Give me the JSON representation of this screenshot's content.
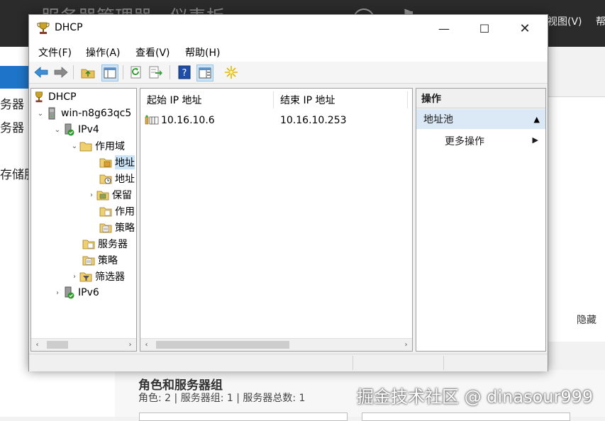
{
  "background_window": {
    "title_fragment": "服务器管理器 · 仪表板",
    "menu_view": "视图(V)",
    "menu_help": "帮",
    "left_items": [
      "务器",
      "务器",
      "存储服"
    ],
    "hide_label": "隐藏",
    "section_title": "角色和服务器组",
    "section_subtitle": "角色: 2 | 服务器组: 1 | 服务器总数: 1"
  },
  "window": {
    "title": "DHCP",
    "minimize": "—",
    "maximize": "☐",
    "close": "✕"
  },
  "menu": [
    "文件(F)",
    "操作(A)",
    "查看(V)",
    "帮助(H)"
  ],
  "tree": {
    "root": "DHCP",
    "server": "win-n8g63qc5",
    "ipv4": "IPv4",
    "scope": "作用域",
    "address_pool": "地址",
    "address_leases": "地址",
    "reservations": "保留",
    "scope_options": "作用",
    "scope_policies": "策略",
    "server_options": "服务器",
    "policies": "策略",
    "filters": "筛选器",
    "ipv6": "IPv6"
  },
  "list": {
    "columns": [
      "起始 IP 地址",
      "结束 IP 地址"
    ],
    "rows": [
      {
        "start": "10.16.10.6",
        "end": "10.16.10.253"
      }
    ]
  },
  "actions": {
    "header": "操作",
    "section": "地址池",
    "more": "更多操作"
  },
  "watermark": "掘金技术社区 @ dinasour999",
  "colors": {
    "accent": "#1e74c8",
    "selection": "#cce4f7",
    "action_section": "#dbe8f6"
  }
}
